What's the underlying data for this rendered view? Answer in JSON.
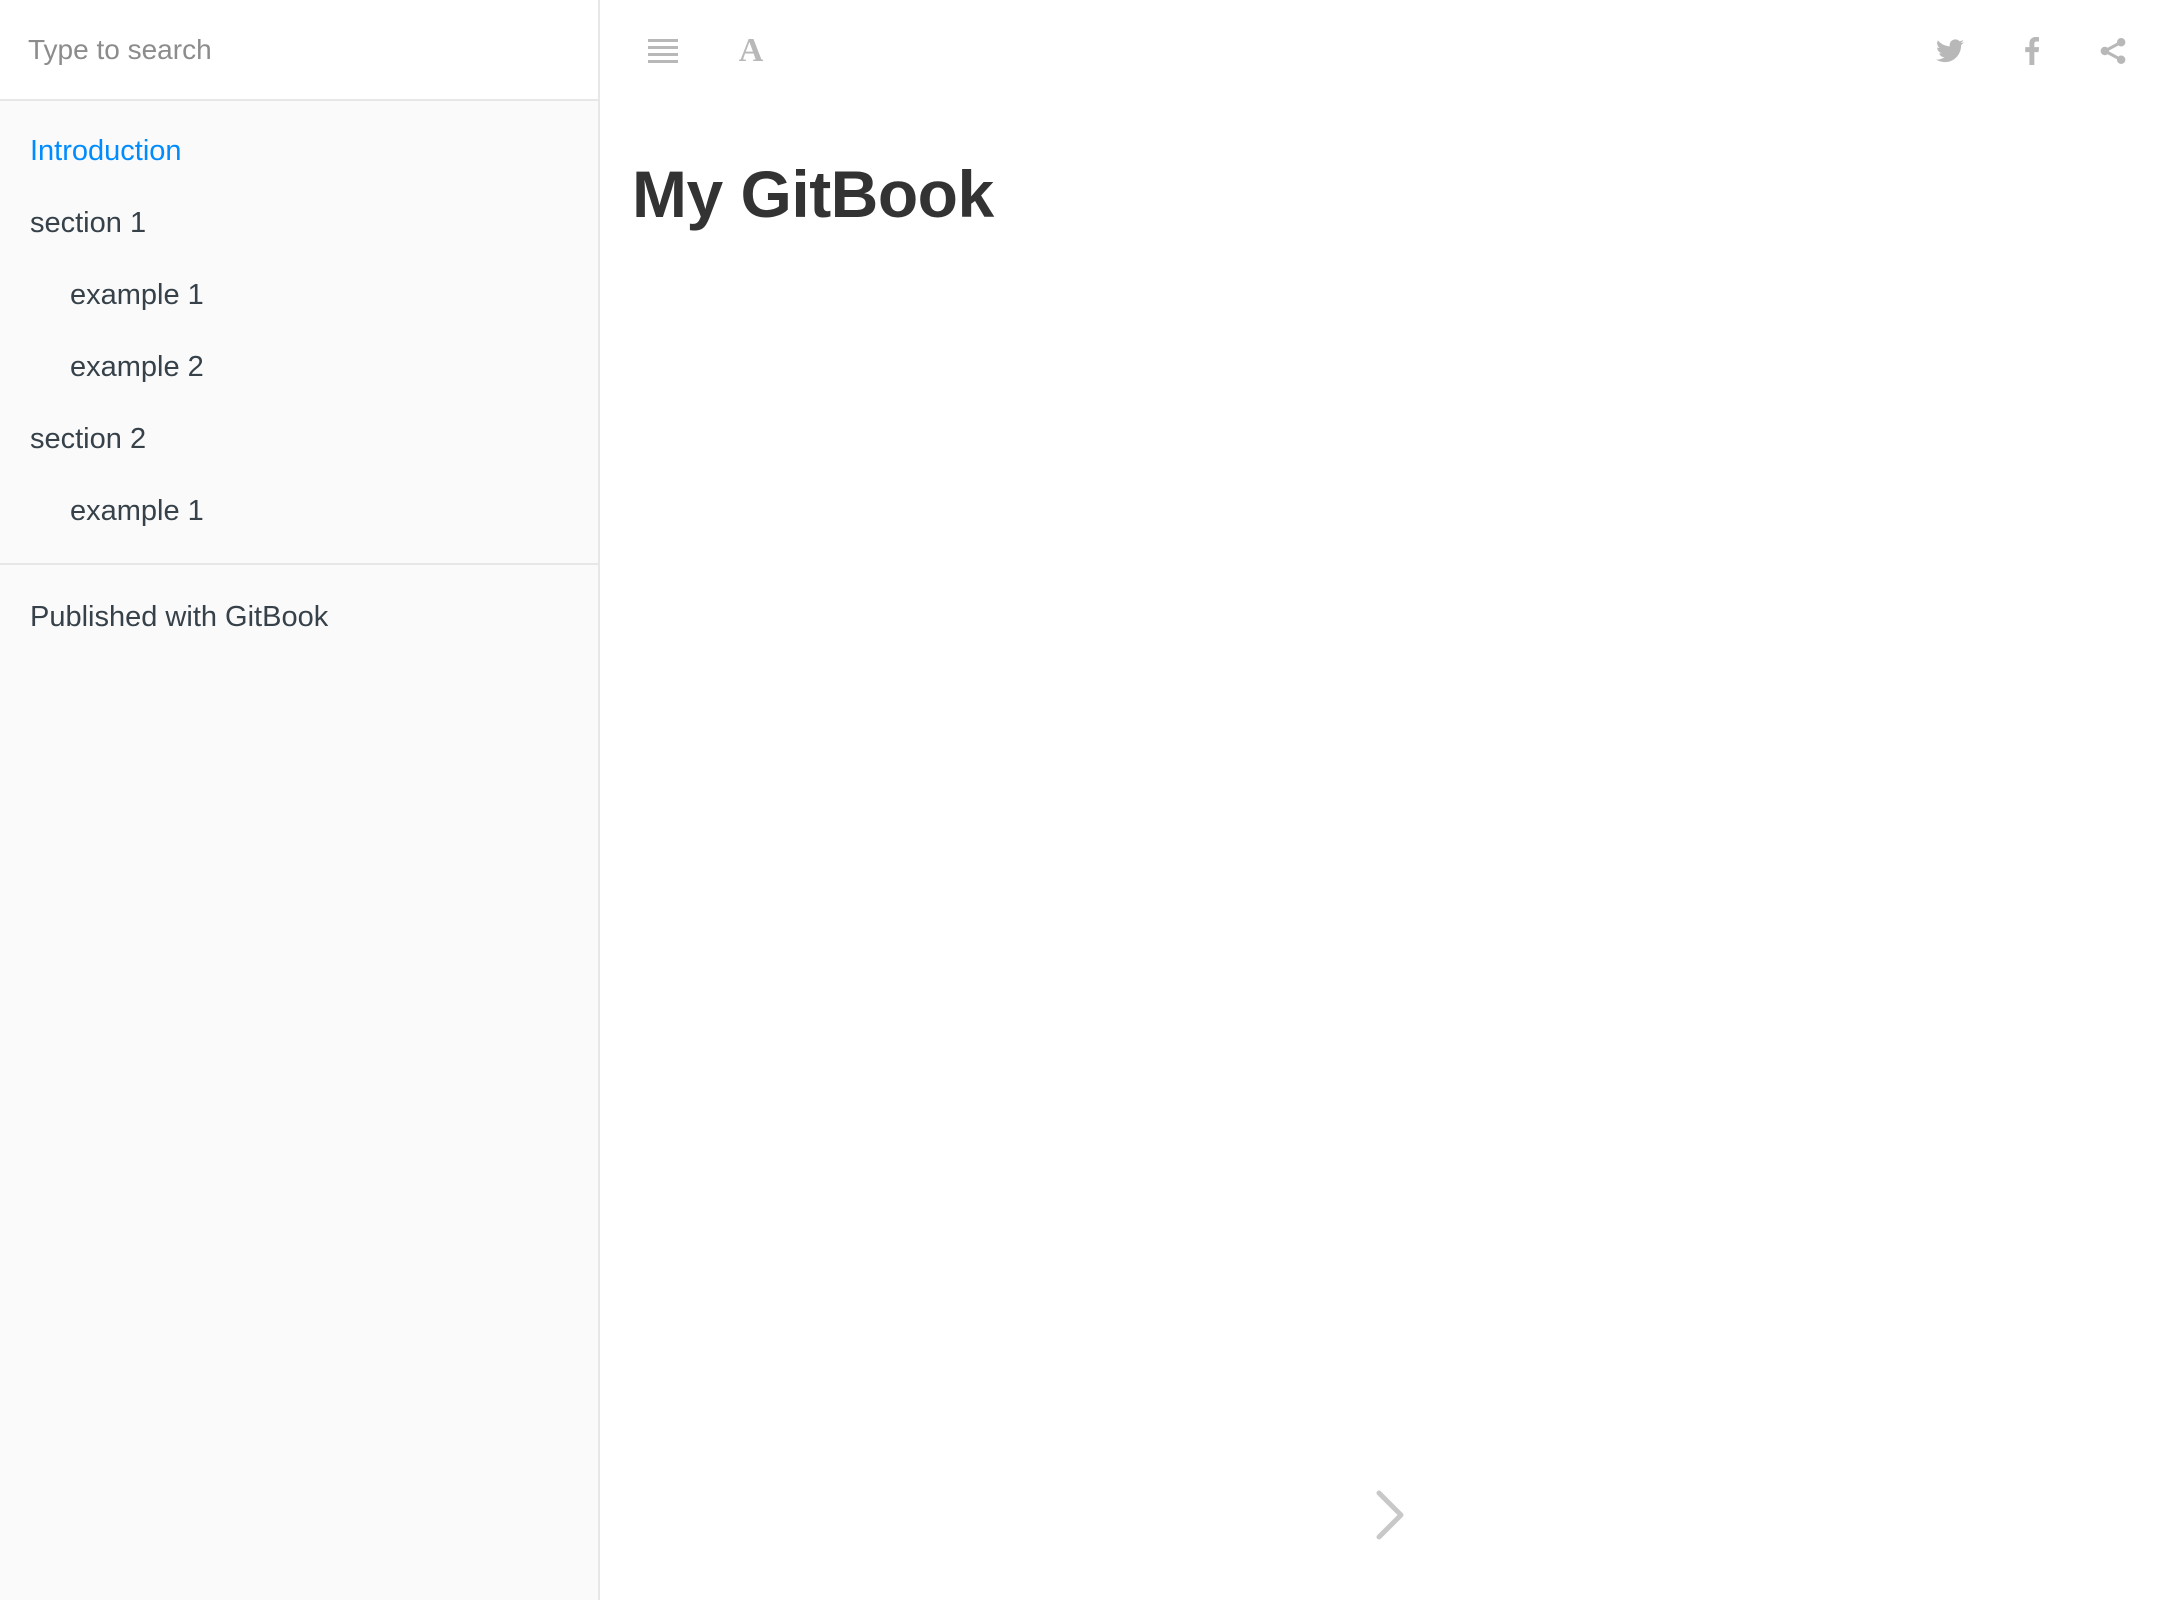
{
  "search": {
    "placeholder": "Type to search"
  },
  "sidebar": {
    "items": [
      {
        "label": "Introduction",
        "active": true
      },
      {
        "label": "section 1"
      },
      {
        "label": "example 1"
      },
      {
        "label": "example 2"
      },
      {
        "label": "section 2"
      },
      {
        "label": "example 1"
      }
    ],
    "published": "Published with GitBook"
  },
  "toolbar": {
    "menu_icon": "menu-icon",
    "font_icon": "font-settings-icon",
    "font_glyph": "A",
    "twitter_icon": "twitter-icon",
    "facebook_icon": "facebook-icon",
    "share_icon": "share-icon"
  },
  "main": {
    "title": "My GitBook"
  },
  "navigation": {
    "next_icon": "chevron-right-icon"
  },
  "colors": {
    "accent": "#008cff",
    "text": "#333333",
    "sidebar_text": "#364149",
    "icon": "#b8b8b8",
    "sidebar_bg": "#fafafa",
    "border": "#e7e7e7"
  }
}
